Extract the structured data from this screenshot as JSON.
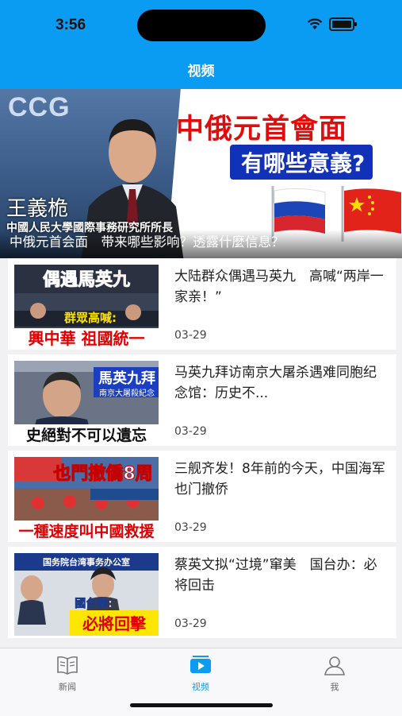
{
  "status": {
    "time": "3:56"
  },
  "nav": {
    "title": "视频"
  },
  "banner": {
    "bg_text": "CCG",
    "headline": "中俄元首會面",
    "subheadline": "有哪些意義?",
    "name": "王義桅",
    "affiliation": "中國人民大學國際事務研究所所長",
    "caption": "中俄元首会面　带来哪些影响？透露什麼信息？"
  },
  "videos": [
    {
      "title": "大陆群众偶遇马英九　高喊“两岸一家亲！”",
      "date": "03-29",
      "thumb_top": "偶遇馬英九",
      "thumb_mid": "群眾高喊:",
      "thumb_bottom": "興中華 祖國統一"
    },
    {
      "title": "马英九拜访南京大屠杀遇难同胞纪念馆：历史不...",
      "date": "03-29",
      "thumb_top": "馬英九拜",
      "thumb_mid": "南京大屠殺紀念",
      "thumb_bottom": "史絕對不可以遺忘"
    },
    {
      "title": "三舰齐发！8年前的今天，中国海军也门撤侨",
      "date": "03-29",
      "thumb_top": "也門撤僑8周",
      "thumb_mid": "",
      "thumb_bottom": "一種速度叫中國救援"
    },
    {
      "title": "蔡英文拟“过境”窜美　国台办：必将回击",
      "date": "03-29",
      "thumb_top": "国务院台湾事务办公室",
      "thumb_mid": "國台辦:",
      "thumb_bottom": "必將回擊"
    }
  ],
  "tabs": [
    {
      "label": "新闻",
      "icon": "book-icon",
      "active": false
    },
    {
      "label": "视频",
      "icon": "video-icon",
      "active": true
    },
    {
      "label": "我",
      "icon": "person-icon",
      "active": false
    }
  ],
  "colors": {
    "accent": "#0a9bf2",
    "headline_red": "#e10c0c"
  }
}
